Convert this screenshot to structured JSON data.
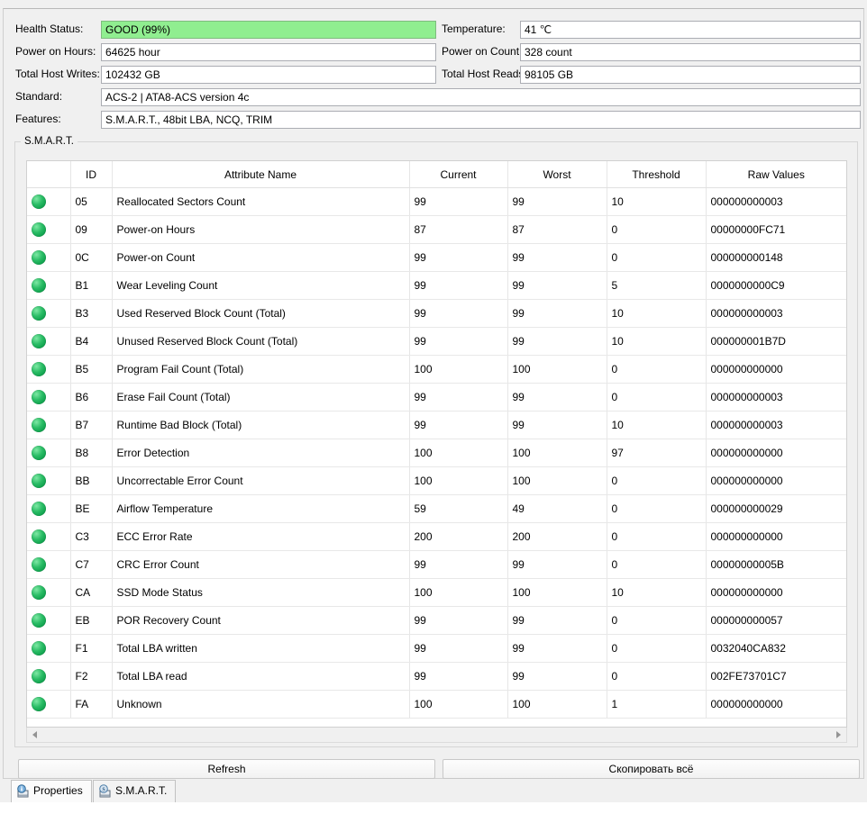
{
  "info": {
    "rows": [
      {
        "left": {
          "label": "Health Status:",
          "value": "GOOD (99%)",
          "highlight": true
        },
        "right": {
          "label": "Temperature:",
          "value": "41 ℃"
        }
      },
      {
        "left": {
          "label": "Power on Hours:",
          "value": "64625 hour"
        },
        "right": {
          "label": "Power on Count:",
          "value": "328 count"
        }
      },
      {
        "left": {
          "label": "Total Host Writes:",
          "value": "102432 GB"
        },
        "right": {
          "label": "Total Host Reads:",
          "value": "98105 GB"
        }
      }
    ],
    "wide_rows": [
      {
        "label": "Standard:",
        "value": "ACS-2 | ATA8-ACS version 4c"
      },
      {
        "label": "Features:",
        "value": "S.M.A.R.T., 48bit LBA, NCQ, TRIM"
      }
    ]
  },
  "smart": {
    "group_label": "S.M.A.R.T.",
    "columns": [
      "",
      "ID",
      "Attribute Name",
      "Current",
      "Worst",
      "Threshold",
      "Raw Values"
    ],
    "status_icon": "green-status-dot-icon",
    "rows": [
      {
        "status": "good",
        "id": "05",
        "name": "Reallocated Sectors Count",
        "current": "99",
        "worst": "99",
        "threshold": "10",
        "raw": "000000000003"
      },
      {
        "status": "good",
        "id": "09",
        "name": "Power-on Hours",
        "current": "87",
        "worst": "87",
        "threshold": "0",
        "raw": "00000000FC71"
      },
      {
        "status": "good",
        "id": "0C",
        "name": "Power-on Count",
        "current": "99",
        "worst": "99",
        "threshold": "0",
        "raw": "000000000148"
      },
      {
        "status": "good",
        "id": "B1",
        "name": "Wear Leveling Count",
        "current": "99",
        "worst": "99",
        "threshold": "5",
        "raw": "0000000000C9"
      },
      {
        "status": "good",
        "id": "B3",
        "name": "Used Reserved Block Count (Total)",
        "current": "99",
        "worst": "99",
        "threshold": "10",
        "raw": "000000000003"
      },
      {
        "status": "good",
        "id": "B4",
        "name": "Unused Reserved Block Count (Total)",
        "current": "99",
        "worst": "99",
        "threshold": "10",
        "raw": "000000001B7D"
      },
      {
        "status": "good",
        "id": "B5",
        "name": "Program Fail Count (Total)",
        "current": "100",
        "worst": "100",
        "threshold": "0",
        "raw": "000000000000"
      },
      {
        "status": "good",
        "id": "B6",
        "name": "Erase Fail Count (Total)",
        "current": "99",
        "worst": "99",
        "threshold": "0",
        "raw": "000000000003"
      },
      {
        "status": "good",
        "id": "B7",
        "name": "Runtime Bad Block (Total)",
        "current": "99",
        "worst": "99",
        "threshold": "10",
        "raw": "000000000003"
      },
      {
        "status": "good",
        "id": "B8",
        "name": "Error Detection",
        "current": "100",
        "worst": "100",
        "threshold": "97",
        "raw": "000000000000"
      },
      {
        "status": "good",
        "id": "BB",
        "name": "Uncorrectable Error Count",
        "current": "100",
        "worst": "100",
        "threshold": "0",
        "raw": "000000000000"
      },
      {
        "status": "good",
        "id": "BE",
        "name": "Airflow Temperature",
        "current": "59",
        "worst": "49",
        "threshold": "0",
        "raw": "000000000029"
      },
      {
        "status": "good",
        "id": "C3",
        "name": "ECC Error Rate",
        "current": "200",
        "worst": "200",
        "threshold": "0",
        "raw": "000000000000"
      },
      {
        "status": "good",
        "id": "C7",
        "name": "CRC Error Count",
        "current": "99",
        "worst": "99",
        "threshold": "0",
        "raw": "00000000005B"
      },
      {
        "status": "good",
        "id": "CA",
        "name": "SSD Mode Status",
        "current": "100",
        "worst": "100",
        "threshold": "10",
        "raw": "000000000000"
      },
      {
        "status": "good",
        "id": "EB",
        "name": "POR Recovery Count",
        "current": "99",
        "worst": "99",
        "threshold": "0",
        "raw": "000000000057"
      },
      {
        "status": "good",
        "id": "F1",
        "name": "Total LBA written",
        "current": "99",
        "worst": "99",
        "threshold": "0",
        "raw": "0032040CA832"
      },
      {
        "status": "good",
        "id": "F2",
        "name": "Total LBA read",
        "current": "99",
        "worst": "99",
        "threshold": "0",
        "raw": "002FE73701C7"
      },
      {
        "status": "good",
        "id": "FA",
        "name": "Unknown",
        "current": "100",
        "worst": "100",
        "threshold": "1",
        "raw": "000000000000"
      }
    ]
  },
  "scrollbar": {
    "left_arrow_icon": "triangle-left-icon",
    "right_arrow_icon": "triangle-right-icon"
  },
  "buttons": {
    "refresh": "Refresh",
    "copy_all": "Скопировать всё"
  },
  "tabs": [
    {
      "label": "Properties",
      "icon": "info-properties-icon",
      "active": false
    },
    {
      "label": "S.M.A.R.T.",
      "icon": "smart-disk-icon",
      "active": true
    }
  ],
  "colors": {
    "health_green": "#90ee90",
    "status_dot_green": "#12a34f",
    "window_bg": "#f0f0f0",
    "field_border": "#abadb3"
  }
}
